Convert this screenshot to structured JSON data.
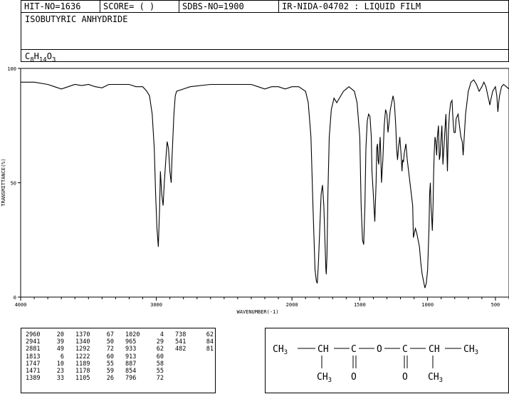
{
  "header": {
    "hit_no": "HIT-NO=1636",
    "score": "SCORE=  (   )",
    "sdbs_no": "SDBS-NO=1900",
    "ir_nida": "IR-NIDA-04702 : LIQUID FILM"
  },
  "compound_name": "ISOBUTYRIC ANHYDRIDE",
  "formula": {
    "c": "C",
    "c_n": "8",
    "h": "H",
    "h_n": "14",
    "o": "O",
    "o_n": "3"
  },
  "chart_data": {
    "type": "line",
    "xlabel": "WAVENUMBER(-1)",
    "ylabel": "TRANSMITTANCE(%)",
    "xlim": [
      4000,
      400
    ],
    "ylim": [
      0,
      100
    ],
    "x_ticks": [
      4000,
      3000,
      2000,
      1500,
      1000,
      500
    ],
    "y_ticks": [
      0,
      50,
      100
    ],
    "grid": false,
    "series": [
      {
        "points": [
          [
            4000,
            94
          ],
          [
            3900,
            94
          ],
          [
            3800,
            93
          ],
          [
            3750,
            92
          ],
          [
            3700,
            91
          ],
          [
            3650,
            92
          ],
          [
            3600,
            93
          ],
          [
            3550,
            92.5
          ],
          [
            3500,
            93
          ],
          [
            3450,
            92
          ],
          [
            3400,
            91.5
          ],
          [
            3350,
            93
          ],
          [
            3300,
            93
          ],
          [
            3200,
            93
          ],
          [
            3150,
            92
          ],
          [
            3100,
            92
          ],
          [
            3070,
            90
          ],
          [
            3050,
            88
          ],
          [
            3030,
            80
          ],
          [
            3015,
            65
          ],
          [
            3005,
            45
          ],
          [
            2995,
            30
          ],
          [
            2985,
            22
          ],
          [
            2975,
            40
          ],
          [
            2970,
            55
          ],
          [
            2960,
            45
          ],
          [
            2950,
            40
          ],
          [
            2941,
            50
          ],
          [
            2930,
            60
          ],
          [
            2920,
            68
          ],
          [
            2910,
            65
          ],
          [
            2900,
            55
          ],
          [
            2890,
            50
          ],
          [
            2885,
            60
          ],
          [
            2870,
            80
          ],
          [
            2860,
            88
          ],
          [
            2850,
            90
          ],
          [
            2800,
            91
          ],
          [
            2750,
            92
          ],
          [
            2600,
            93
          ],
          [
            2400,
            93
          ],
          [
            2300,
            93
          ],
          [
            2250,
            92
          ],
          [
            2200,
            91
          ],
          [
            2150,
            92
          ],
          [
            2100,
            92
          ],
          [
            2050,
            91
          ],
          [
            2000,
            92
          ],
          [
            1950,
            92
          ],
          [
            1900,
            90
          ],
          [
            1880,
            85
          ],
          [
            1860,
            70
          ],
          [
            1845,
            40
          ],
          [
            1830,
            12
          ],
          [
            1820,
            7
          ],
          [
            1813,
            6
          ],
          [
            1805,
            15
          ],
          [
            1795,
            30
          ],
          [
            1785,
            45
          ],
          [
            1775,
            49
          ],
          [
            1765,
            40
          ],
          [
            1757,
            25
          ],
          [
            1750,
            12
          ],
          [
            1747,
            10
          ],
          [
            1742,
            18
          ],
          [
            1735,
            45
          ],
          [
            1725,
            70
          ],
          [
            1710,
            82
          ],
          [
            1690,
            87
          ],
          [
            1670,
            85
          ],
          [
            1640,
            88
          ],
          [
            1620,
            90
          ],
          [
            1600,
            91
          ],
          [
            1580,
            92
          ],
          [
            1560,
            91
          ],
          [
            1540,
            90
          ],
          [
            1520,
            85
          ],
          [
            1500,
            70
          ],
          [
            1490,
            40
          ],
          [
            1480,
            25
          ],
          [
            1471,
            23
          ],
          [
            1462,
            40
          ],
          [
            1455,
            65
          ],
          [
            1445,
            77
          ],
          [
            1435,
            80
          ],
          [
            1425,
            79
          ],
          [
            1415,
            70
          ],
          [
            1410,
            55
          ],
          [
            1400,
            45
          ],
          [
            1389,
            33
          ],
          [
            1380,
            50
          ],
          [
            1375,
            65
          ],
          [
            1370,
            67
          ],
          [
            1365,
            60
          ],
          [
            1360,
            58
          ],
          [
            1355,
            65
          ],
          [
            1350,
            70
          ],
          [
            1345,
            62
          ],
          [
            1340,
            50
          ],
          [
            1335,
            55
          ],
          [
            1330,
            60
          ],
          [
            1320,
            75
          ],
          [
            1310,
            82
          ],
          [
            1300,
            80
          ],
          [
            1292,
            72
          ],
          [
            1285,
            76
          ],
          [
            1275,
            82
          ],
          [
            1265,
            85
          ],
          [
            1255,
            88
          ],
          [
            1245,
            85
          ],
          [
            1235,
            75
          ],
          [
            1228,
            65
          ],
          [
            1222,
            60
          ],
          [
            1215,
            65
          ],
          [
            1205,
            70
          ],
          [
            1195,
            62
          ],
          [
            1189,
            55
          ],
          [
            1184,
            60
          ],
          [
            1178,
            59
          ],
          [
            1172,
            63
          ],
          [
            1160,
            67
          ],
          [
            1150,
            60
          ],
          [
            1140,
            55
          ],
          [
            1130,
            50
          ],
          [
            1120,
            45
          ],
          [
            1110,
            40
          ],
          [
            1105,
            26
          ],
          [
            1098,
            28
          ],
          [
            1090,
            30
          ],
          [
            1080,
            28
          ],
          [
            1070,
            25
          ],
          [
            1060,
            22
          ],
          [
            1050,
            15
          ],
          [
            1040,
            10
          ],
          [
            1030,
            7
          ],
          [
            1020,
            4
          ],
          [
            1010,
            6
          ],
          [
            1000,
            12
          ],
          [
            990,
            30
          ],
          [
            985,
            45
          ],
          [
            980,
            50
          ],
          [
            975,
            40
          ],
          [
            970,
            35
          ],
          [
            965,
            29
          ],
          [
            960,
            40
          ],
          [
            955,
            55
          ],
          [
            950,
            65
          ],
          [
            945,
            70
          ],
          [
            940,
            68
          ],
          [
            933,
            62
          ],
          [
            928,
            70
          ],
          [
            920,
            75
          ],
          [
            913,
            60
          ],
          [
            908,
            62
          ],
          [
            900,
            70
          ],
          [
            895,
            75
          ],
          [
            887,
            58
          ],
          [
            880,
            65
          ],
          [
            870,
            75
          ],
          [
            865,
            80
          ],
          [
            854,
            55
          ],
          [
            848,
            70
          ],
          [
            840,
            80
          ],
          [
            830,
            85
          ],
          [
            820,
            86
          ],
          [
            815,
            80
          ],
          [
            810,
            75
          ],
          [
            805,
            72
          ],
          [
            796,
            72
          ],
          [
            790,
            78
          ],
          [
            775,
            80
          ],
          [
            765,
            75
          ],
          [
            755,
            70
          ],
          [
            745,
            68
          ],
          [
            738,
            62
          ],
          [
            730,
            70
          ],
          [
            720,
            80
          ],
          [
            700,
            90
          ],
          [
            680,
            94
          ],
          [
            660,
            95
          ],
          [
            640,
            93
          ],
          [
            620,
            90
          ],
          [
            600,
            92
          ],
          [
            585,
            94
          ],
          [
            570,
            92
          ],
          [
            556,
            88
          ],
          [
            548,
            86
          ],
          [
            541,
            84
          ],
          [
            535,
            86
          ],
          [
            520,
            90
          ],
          [
            500,
            92
          ],
          [
            490,
            88
          ],
          [
            482,
            81
          ],
          [
            476,
            85
          ],
          [
            470,
            88
          ],
          [
            455,
            92
          ],
          [
            440,
            93
          ],
          [
            420,
            92
          ],
          [
            400,
            91
          ]
        ]
      }
    ]
  },
  "peaks": [
    [
      [
        "2960",
        "20"
      ],
      [
        "2941",
        "39"
      ],
      [
        "2881",
        "49"
      ],
      [
        "1813",
        "6"
      ],
      [
        "1747",
        "10"
      ],
      [
        "1471",
        "23"
      ],
      [
        "1389",
        "33"
      ]
    ],
    [
      [
        "1370",
        "67"
      ],
      [
        "1340",
        "50"
      ],
      [
        "1292",
        "72"
      ],
      [
        "1222",
        "60"
      ],
      [
        "1189",
        "55"
      ],
      [
        "1178",
        "59"
      ],
      [
        "1105",
        "26"
      ]
    ],
    [
      [
        "1020",
        "4"
      ],
      [
        "965",
        "29"
      ],
      [
        "933",
        "62"
      ],
      [
        "913",
        "60"
      ],
      [
        "887",
        "58"
      ],
      [
        "854",
        "55"
      ],
      [
        "796",
        "72"
      ]
    ],
    [
      [
        "738",
        "62"
      ],
      [
        "541",
        "84"
      ],
      [
        "482",
        "81"
      ]
    ]
  ],
  "structure": {
    "ch3_left": "CH",
    "ch_left": "CH",
    "c1": "C",
    "o_bridge": "O",
    "c2": "C",
    "ch_right": "CH",
    "ch3_right": "CH",
    "sub3": "3",
    "dash": "—",
    "ch3_down_left": "CH",
    "o_down_1": "O",
    "o_down_2": "O",
    "ch3_down_right": "CH"
  }
}
